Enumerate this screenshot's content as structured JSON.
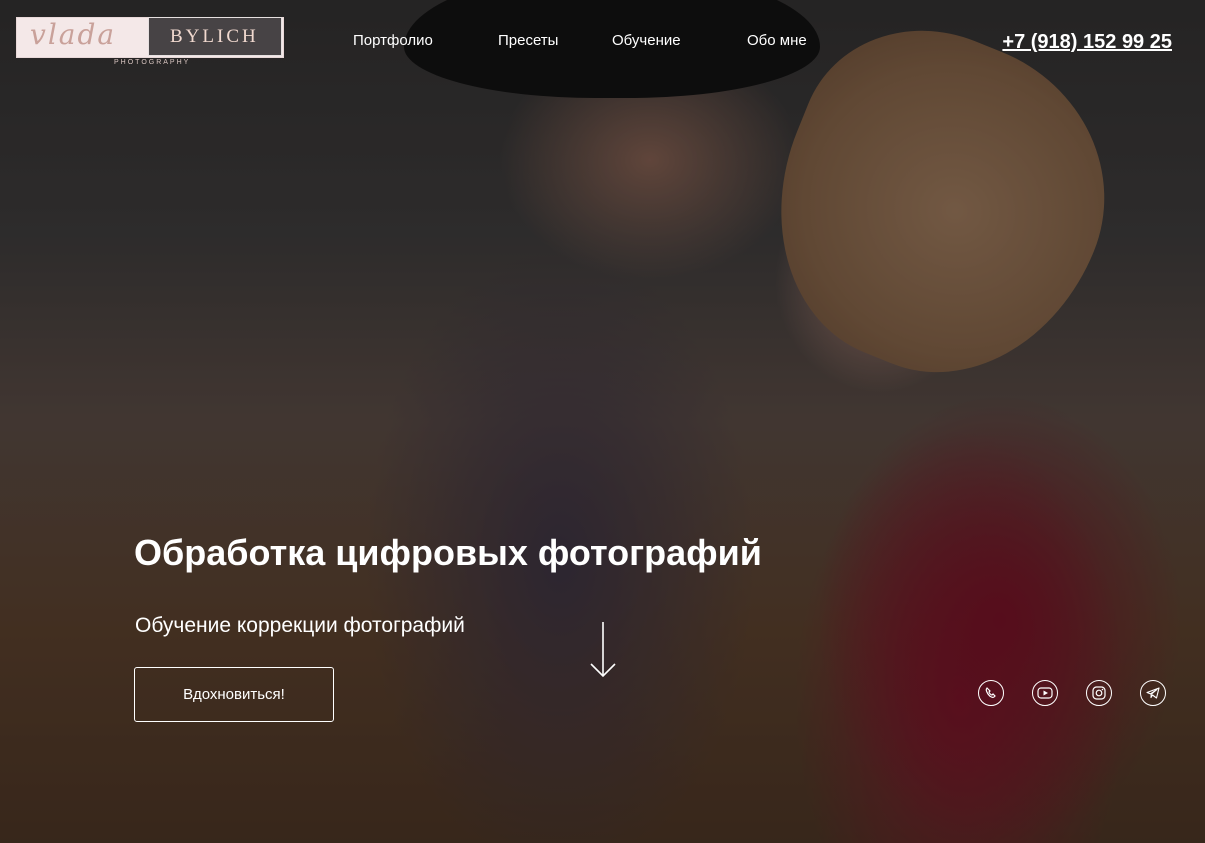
{
  "header": {
    "logo": {
      "script": "vlada",
      "word": "BYLICH",
      "sub": "PHOTOGRAPHY"
    },
    "nav": [
      "Портфолио",
      "Пресеты",
      "Обучение",
      "Обо мне"
    ],
    "phone": "+7 (918) 152 99 25"
  },
  "hero": {
    "title": "Обработка цифровых фотографий",
    "subtitle": "Обучение коррекции фотографий",
    "cta_label": "Вдохновиться!",
    "scroll_icon": "arrow-down-icon"
  },
  "socials": [
    {
      "icon": "whatsapp-icon"
    },
    {
      "icon": "youtube-icon"
    },
    {
      "icon": "instagram-icon"
    },
    {
      "icon": "telegram-icon"
    }
  ],
  "colors": {
    "logo_bg": "#f4e8e8",
    "logo_accent": "#c9a19a",
    "overlay": "rgba(0,0,0,0.38)",
    "text": "#ffffff"
  }
}
